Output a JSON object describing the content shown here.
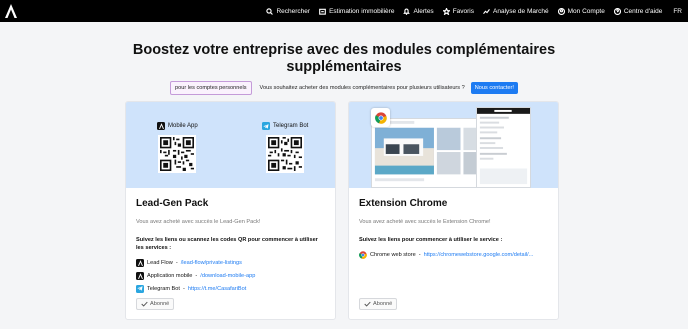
{
  "nav": {
    "items": [
      {
        "label": "Rechercher",
        "icon": "search-icon"
      },
      {
        "label": "Estimation immobilière",
        "icon": "estimate-icon"
      },
      {
        "label": "Alertes",
        "icon": "bell-icon"
      },
      {
        "label": "Favoris",
        "icon": "star-icon"
      },
      {
        "label": "Analyse de Marché",
        "icon": "chart-icon"
      },
      {
        "label": "Mon Compte",
        "icon": "user-icon"
      },
      {
        "label": "Centre d'aide",
        "icon": "help-icon"
      }
    ],
    "language": "FR"
  },
  "hero": {
    "title_line1": "Boostez votre entreprise avec des modules complémentaires",
    "title_line2": "supplémentaires",
    "personal_label": "pour les comptes personnels",
    "multi_user_text": "Vous souhaitez acheter des modules complémentaires pour plusieurs utilisateurs ?",
    "contact_label": "Nous contacter!"
  },
  "cards": [
    {
      "title": "Lead-Gen Pack",
      "subtitle": "Vous avez acheté avec succès le Lead-Gen Pack!",
      "instruction": "Suivez les liens ou scannez les codes QR pour commencer à utiliser les services :",
      "banner": {
        "qr1_label": "Mobile App",
        "qr2_label": "Telegram Bot"
      },
      "links": [
        {
          "name": "Lead Flow",
          "url": "/lead-flow/private-listings",
          "icon": "casafari-icon"
        },
        {
          "name": "Application mobile",
          "url": "/download-mobile-app",
          "icon": "casafari-icon"
        },
        {
          "name": "Telegram Bot",
          "url": "https://t.me/CasafariBot",
          "icon": "telegram-icon"
        }
      ],
      "status": "Abonné"
    },
    {
      "title": "Extension Chrome",
      "subtitle": "Vous avez acheté avec succès le Extension Chrome!",
      "instruction": "Suivez les liens pour commencer à utiliser le service :",
      "links": [
        {
          "name": "Chrome web store",
          "url": "https://chromewebstore.google.com/detail/...",
          "icon": "chrome-icon"
        }
      ],
      "status": "Abonné"
    }
  ],
  "colors": {
    "topbar": "#000000",
    "accent": "#1d7bf2",
    "banner": "#cfe3fb",
    "telegram": "#2aa6e0"
  }
}
